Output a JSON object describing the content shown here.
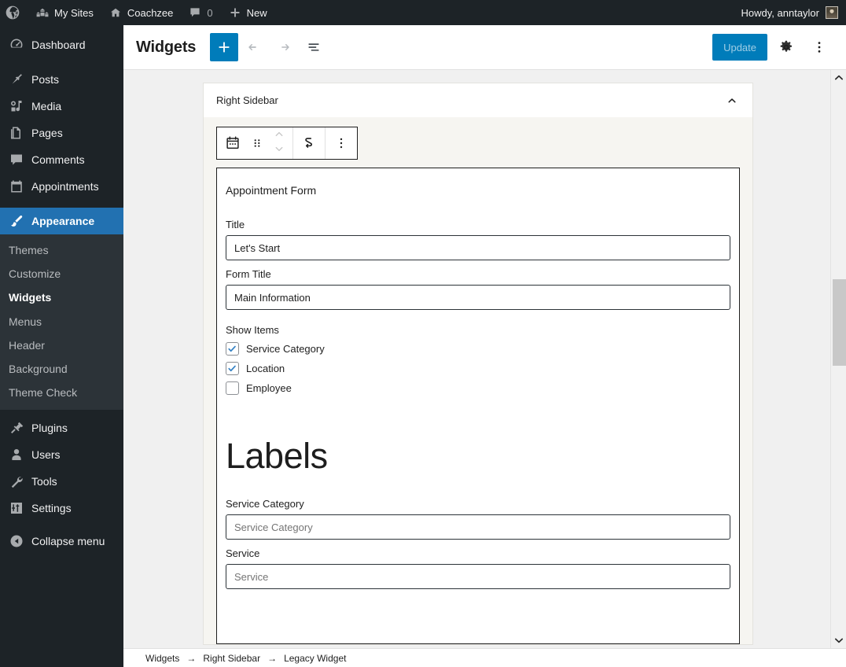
{
  "adminbar": {
    "logo_icon": "wordpress-logo-icon",
    "items": [
      {
        "label": "My Sites",
        "icon": "sites-icon"
      },
      {
        "label": "Coachzee",
        "icon": "home-icon"
      },
      {
        "label": "0",
        "icon": "comment-bubble-icon"
      },
      {
        "label": "New",
        "icon": "plus-icon"
      }
    ],
    "howdy": "Howdy, anntaylor",
    "avatar_icon": "user-avatar"
  },
  "sidebar": {
    "items": [
      {
        "label": "Dashboard",
        "icon": "dashboard-icon",
        "current": false
      },
      {
        "label": "Posts",
        "icon": "pin-icon",
        "current": false
      },
      {
        "label": "Media",
        "icon": "media-icon",
        "current": false
      },
      {
        "label": "Pages",
        "icon": "pages-icon",
        "current": false
      },
      {
        "label": "Comments",
        "icon": "comments-icon",
        "current": false
      },
      {
        "label": "Appointments",
        "icon": "calendar-icon",
        "current": false
      },
      {
        "label": "Appearance",
        "icon": "paintbrush-icon",
        "current": true
      }
    ],
    "submenu": [
      {
        "label": "Themes",
        "current": false
      },
      {
        "label": "Customize",
        "current": false
      },
      {
        "label": "Widgets",
        "current": true
      },
      {
        "label": "Menus",
        "current": false
      },
      {
        "label": "Header",
        "current": false
      },
      {
        "label": "Background",
        "current": false
      },
      {
        "label": "Theme Check",
        "current": false
      }
    ],
    "items_bottom": [
      {
        "label": "Plugins",
        "icon": "plug-icon"
      },
      {
        "label": "Users",
        "icon": "user-icon"
      },
      {
        "label": "Tools",
        "icon": "wrench-icon"
      },
      {
        "label": "Settings",
        "icon": "sliders-icon"
      }
    ],
    "collapse": {
      "label": "Collapse menu",
      "icon": "collapse-arrow-icon"
    }
  },
  "header": {
    "title": "Widgets",
    "inserter_icon": "plus-icon",
    "undo_icon": "undo-arrow-icon",
    "redo_icon": "redo-arrow-icon",
    "list_view_icon": "list-view-icon",
    "update_label": "Update",
    "settings_icon": "gear-icon",
    "options_icon": "more-vertical-icon"
  },
  "panel": {
    "title": "Right Sidebar",
    "collapse_icon": "chevron-up-icon",
    "toolbar": {
      "block_type_icon": "calendar-icon",
      "drag_icon": "drag-handle-icon",
      "move_up_icon": "chevron-up-icon",
      "move_down_icon": "chevron-down-icon",
      "transform_icon": "loop-arrow-icon",
      "more_icon": "more-vertical-icon"
    }
  },
  "widget": {
    "title": "Appointment Form",
    "fields": [
      {
        "label": "Title",
        "value": "Let's Start",
        "placeholder": ""
      },
      {
        "label": "Form Title",
        "value": "Main Information",
        "placeholder": ""
      }
    ],
    "show_items_label": "Show Items",
    "checkboxes": [
      {
        "label": "Service Category",
        "checked": true
      },
      {
        "label": "Location",
        "checked": true
      },
      {
        "label": "Employee",
        "checked": false
      }
    ],
    "labels_heading": "Labels",
    "label_fields": [
      {
        "label": "Service Category",
        "value": "",
        "placeholder": "Service Category"
      },
      {
        "label": "Service",
        "value": "",
        "placeholder": "Service"
      }
    ]
  },
  "breadcrumb": {
    "items": [
      "Widgets",
      "Right Sidebar",
      "Legacy Widget"
    ],
    "separator": "→"
  },
  "scrollbar": {
    "up_icon": "chevron-up-icon",
    "down_icon": "chevron-down-icon"
  },
  "colors": {
    "wp_dark": "#1d2327",
    "wp_submenu": "#2c3338",
    "accent_blue": "#2271b1",
    "button_blue": "#007cba",
    "canvas_bg": "#f0f0f0",
    "panel_bg": "#f6f5f1"
  }
}
